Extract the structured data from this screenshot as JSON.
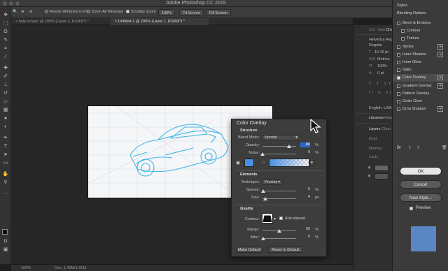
{
  "window": {
    "title": "Adobe Photoshop CC 2015"
  },
  "options_bar": {
    "resize_windows_label": "Resize Windows to Fit",
    "zoom_all_windows_label": "Zoom All Windows",
    "scrubby_zoom_label": "Scrubby Zoom",
    "zoom_value": "100%",
    "fit_screen_label": "Fit Screen",
    "fill_screen_label": "Fill Screen"
  },
  "doc_tabs": [
    {
      "label": "help screen @ 200% (Layer 3, RGB/8*) *"
    },
    {
      "label": "Untitled-1 @ 200% (Layer 1, RGB/8*) *"
    }
  ],
  "status_bar": {
    "zoom": "100%",
    "doc_info": "Doc: 1.43M/1.91M"
  },
  "mid_panel": {
    "tabs": [
      "Col",
      "Swa",
      "Cha"
    ],
    "font_name": "Helvetica Regu",
    "font_style": "Regular",
    "font_size": "10.19 pt",
    "font_metrics": "Metrics",
    "font_scale": "100%",
    "font_baseline": "0 pt",
    "language": "English: USA",
    "libraries_tab": "Libraries",
    "adjustments_tab": "Adju",
    "layers_tab": "Layers",
    "channels_tab": "Chan",
    "kind_label": "Kind",
    "normal_label": "Normal",
    "lock_label": "Lock:"
  },
  "color_overlay": {
    "title": "Color Overlay",
    "structure_label": "Structure",
    "blend_mode_label": "Blend Mode:",
    "blend_mode_value": "Normal",
    "opacity_label": "Opacity:",
    "opacity_value": "80",
    "opacity_level": 0.8,
    "noise_label": "Noise:",
    "noise_value": "0",
    "noise_level": 0,
    "overlay_color": "#4a90e2",
    "elements_label": "Elements",
    "technique_label": "Technique:",
    "technique_value": "Precise",
    "spread_label": "Spread:",
    "spread_value": "0",
    "size_label": "Size:",
    "size_value": "4",
    "quality_label": "Quality",
    "contour_label": "Contour:",
    "anti_aliased_label": "Anti-aliased",
    "range_label": "Range:",
    "range_value": "50",
    "range_level": 0.5,
    "jitter_label": "Jitter:",
    "jitter_value": "0",
    "percent_unit": "%",
    "px_unit": "px",
    "make_default_label": "Make Default",
    "reset_default_label": "Reset to Default"
  },
  "layer_style": {
    "styles_label": "Styles",
    "blending_options_label": "Blending Options",
    "items": [
      {
        "label": "Bevel & Emboss",
        "checked": false,
        "plus": false,
        "indent": false
      },
      {
        "label": "Contour",
        "checked": false,
        "plus": false,
        "indent": true
      },
      {
        "label": "Texture",
        "checked": false,
        "plus": false,
        "indent": true
      },
      {
        "label": "Stroke",
        "checked": false,
        "plus": true,
        "indent": false
      },
      {
        "label": "Inner Shadow",
        "checked": false,
        "plus": true,
        "indent": false
      },
      {
        "label": "Inner Glow",
        "checked": false,
        "plus": false,
        "indent": false
      },
      {
        "label": "Satin",
        "checked": false,
        "plus": false,
        "indent": false
      },
      {
        "label": "Color Overlay",
        "checked": true,
        "plus": true,
        "indent": false
      },
      {
        "label": "Gradient Overlay",
        "checked": false,
        "plus": true,
        "indent": false
      },
      {
        "label": "Pattern Overlay",
        "checked": false,
        "plus": false,
        "indent": false
      },
      {
        "label": "Outer Glow",
        "checked": false,
        "plus": false,
        "indent": false
      },
      {
        "label": "Drop Shadow",
        "checked": false,
        "plus": true,
        "indent": false
      }
    ],
    "fx_label": "fx",
    "ok_label": "OK",
    "cancel_label": "Cancel",
    "new_style_label": "New Style...",
    "preview_label": "Preview",
    "preview_color": "#5b86c4"
  }
}
